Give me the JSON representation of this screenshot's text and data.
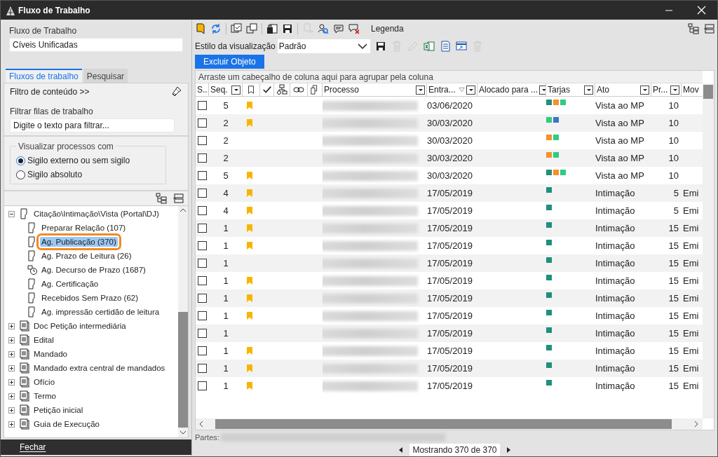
{
  "window": {
    "title": "Fluxo de Trabalho"
  },
  "left": {
    "workflow_label": "Fluxo de Trabalho",
    "workflow_value": "Cíveis Unificadas",
    "tabs": [
      {
        "label": "Fluxos de trabalho",
        "selected": true
      },
      {
        "label": "Pesquisar",
        "selected": false
      }
    ],
    "content_filter": "Filtro de conteúdo >>",
    "queue_filter_label": "Filtrar filas de trabalho",
    "queue_filter_placeholder": "Digite o texto para filtrar...",
    "view_group": {
      "legend": "Visualizar processos com",
      "options": [
        {
          "label": "Sigilo externo ou sem sigilo",
          "selected": true
        },
        {
          "label": "Sigilo absoluto",
          "selected": false
        }
      ]
    },
    "tree": [
      {
        "label": "Citação\\Intimação\\Vista (Portal\\DJ)",
        "kind": "queue",
        "expanded": true,
        "selected": false,
        "children": [
          {
            "label": "Preparar Relação (107)",
            "kind": "queue",
            "selected": false
          },
          {
            "label": "Ag. Publicação (370)",
            "kind": "queue",
            "selected": true
          },
          {
            "label": "Ag. Prazo de Leitura (26)",
            "kind": "queue",
            "selected": false
          },
          {
            "label": "Ag. Decurso de Prazo (1687)",
            "kind": "timer",
            "selected": false
          },
          {
            "label": "Ag. Certificação",
            "kind": "queue",
            "selected": false
          },
          {
            "label": "Recebidos Sem Prazo (62)",
            "kind": "queue",
            "selected": false
          },
          {
            "label": "Ag. impressão certidão de leitura",
            "kind": "queue",
            "selected": false
          }
        ]
      },
      {
        "label": "Doc Petição intermediária",
        "kind": "group",
        "expanded": false,
        "selected": false
      },
      {
        "label": "Edital",
        "kind": "group",
        "expanded": false,
        "selected": false
      },
      {
        "label": "Mandado",
        "kind": "group",
        "expanded": false,
        "selected": false
      },
      {
        "label": "Mandado extra central de mandados",
        "kind": "group",
        "expanded": false,
        "selected": false
      },
      {
        "label": "Ofício",
        "kind": "group",
        "expanded": false,
        "selected": false
      },
      {
        "label": "Termo",
        "kind": "group",
        "expanded": false,
        "selected": false
      },
      {
        "label": "Petição inicial",
        "kind": "group",
        "expanded": false,
        "selected": false
      },
      {
        "label": "Guia de Execução",
        "kind": "group",
        "expanded": false,
        "selected": false
      }
    ],
    "close_button": "Fechar"
  },
  "toolbar": {
    "tools": [
      {
        "kind": "folder",
        "disabled": false
      },
      {
        "kind": "refresh",
        "disabled": false
      },
      {
        "kind": "checklist",
        "disabled": false
      },
      {
        "kind": "copy",
        "disabled": false
      },
      {
        "kind": "lock",
        "disabled": false
      },
      {
        "kind": "save",
        "disabled": false
      },
      {
        "kind": "export",
        "disabled": true
      },
      {
        "kind": "search",
        "disabled": false
      },
      {
        "kind": "comment",
        "disabled": false
      },
      {
        "kind": "comment-delete",
        "disabled": false
      }
    ],
    "legend": "Legenda"
  },
  "view_style": {
    "label": "Estilo da visualização",
    "value": "Padrão",
    "tools": [
      {
        "kind": "save",
        "disabled": false
      },
      {
        "kind": "trash",
        "disabled": true
      },
      {
        "kind": "pencil",
        "disabled": true
      },
      {
        "kind": "excel",
        "disabled": false
      },
      {
        "kind": "document",
        "disabled": false
      },
      {
        "kind": "window",
        "disabled": false
      },
      {
        "kind": "trash",
        "disabled": true
      }
    ]
  },
  "delete_button": "Excluir Objeto",
  "table": {
    "group_hint": "Arraste um cabeçalho de coluna aqui para agrupar pela coluna",
    "columns": [
      {
        "label": "S...",
        "kind": "text"
      },
      {
        "label": "Seq.",
        "kind": "text",
        "filter": true
      },
      {
        "kind": "bookmark"
      },
      {
        "kind": "check"
      },
      {
        "kind": "flow"
      },
      {
        "kind": "link"
      },
      {
        "kind": "document"
      },
      {
        "label": "Processo",
        "kind": "text",
        "filter": true
      },
      {
        "label": "Entra...",
        "kind": "text",
        "filter": true,
        "sorted": true
      },
      {
        "label": "Alocado para ...",
        "kind": "text",
        "filter": true
      },
      {
        "label": "Tarjas",
        "kind": "text",
        "filter": true
      },
      {
        "label": "Ato",
        "kind": "text",
        "filter": true
      },
      {
        "label": "Pr...",
        "kind": "text",
        "filter": true
      },
      {
        "label": "Mov",
        "kind": "text",
        "filter": false
      }
    ],
    "rows": [
      {
        "checked": false,
        "seq": "5",
        "flagged": true,
        "date": "03/06/2020",
        "tags": [
          {
            "color": "#1f8f80"
          },
          {
            "color": "#f5902a"
          },
          {
            "color": "#2ecc80"
          }
        ],
        "act": "Vista ao MP",
        "pr": "10"
      },
      {
        "checked": false,
        "seq": "2",
        "flagged": true,
        "date": "30/03/2020",
        "tags": [
          {
            "color": "#2ecc80"
          },
          {
            "color": "#3a76c4"
          }
        ],
        "act": "Vista ao MP",
        "pr": "10"
      },
      {
        "checked": false,
        "seq": "2",
        "flagged": false,
        "date": "30/03/2020",
        "tags": [
          {
            "color": "#f5902a"
          },
          {
            "color": "#2ecc80"
          }
        ],
        "act": "Vista ao MP",
        "pr": "10"
      },
      {
        "checked": false,
        "seq": "2",
        "flagged": false,
        "date": "30/03/2020",
        "tags": [
          {
            "color": "#f5902a"
          },
          {
            "color": "#2ecc80"
          }
        ],
        "act": "Vista ao MP",
        "pr": "10"
      },
      {
        "checked": false,
        "seq": "5",
        "flagged": true,
        "date": "30/03/2020",
        "tags": [
          {
            "color": "#1f8f80"
          },
          {
            "color": "#f5902a"
          },
          {
            "color": "#2ecc80"
          }
        ],
        "act": "Vista ao MP",
        "pr": "10"
      },
      {
        "checked": false,
        "seq": "4",
        "flagged": true,
        "date": "17/05/2019",
        "tags": [
          {
            "color": "#1f8f80"
          }
        ],
        "act": "Intimação",
        "pr": "5",
        "mov": "Emi"
      },
      {
        "checked": false,
        "seq": "4",
        "flagged": true,
        "date": "17/05/2019",
        "tags": [
          {
            "color": "#1f8f80"
          }
        ],
        "act": "Intimação",
        "pr": "5",
        "mov": "Emi"
      },
      {
        "checked": false,
        "seq": "1",
        "flagged": true,
        "date": "17/05/2019",
        "tags": [
          {
            "color": "#1f8f80"
          }
        ],
        "act": "Intimação",
        "pr": "15",
        "mov": "Emi"
      },
      {
        "checked": false,
        "seq": "1",
        "flagged": true,
        "date": "17/05/2019",
        "tags": [
          {
            "color": "#1f8f80"
          }
        ],
        "act": "Intimação",
        "pr": "15",
        "mov": "Emi"
      },
      {
        "checked": false,
        "seq": "1",
        "flagged": false,
        "date": "17/05/2019",
        "tags": [
          {
            "color": "#1f8f80"
          }
        ],
        "act": "Intimação",
        "pr": "15",
        "mov": "Emi"
      },
      {
        "checked": false,
        "seq": "1",
        "flagged": true,
        "date": "17/05/2019",
        "tags": [
          {
            "color": "#1f8f80"
          }
        ],
        "act": "Intimação",
        "pr": "15",
        "mov": "Emi"
      },
      {
        "checked": false,
        "seq": "1",
        "flagged": true,
        "date": "17/05/2019",
        "tags": [
          {
            "color": "#1f8f80"
          }
        ],
        "act": "Intimação",
        "pr": "15",
        "mov": "Emi"
      },
      {
        "checked": false,
        "seq": "1",
        "flagged": true,
        "date": "17/05/2019",
        "tags": [
          {
            "color": "#1f8f80"
          }
        ],
        "act": "Intimação",
        "pr": "15",
        "mov": "Emi"
      },
      {
        "checked": false,
        "seq": "1",
        "flagged": false,
        "date": "17/05/2019",
        "tags": [
          {
            "color": "#1f8f80"
          }
        ],
        "act": "Intimação",
        "pr": "15",
        "mov": "Emi"
      },
      {
        "checked": false,
        "seq": "1",
        "flagged": true,
        "date": "17/05/2019",
        "tags": [
          {
            "color": "#1f8f80"
          }
        ],
        "act": "Intimação",
        "pr": "15",
        "mov": "Emi"
      },
      {
        "checked": false,
        "seq": "1",
        "flagged": true,
        "date": "17/05/2019",
        "tags": [
          {
            "color": "#1f8f80"
          }
        ],
        "act": "Intimação",
        "pr": "15",
        "mov": "Emi"
      },
      {
        "checked": false,
        "seq": "1",
        "flagged": true,
        "date": "17/05/2019",
        "tags": [
          {
            "color": "#1f8f80"
          }
        ],
        "act": "Intimação",
        "pr": "15",
        "mov": "Emi"
      }
    ]
  },
  "parts_label": "Partes:",
  "pager": "Mostrando 370 de 370"
}
